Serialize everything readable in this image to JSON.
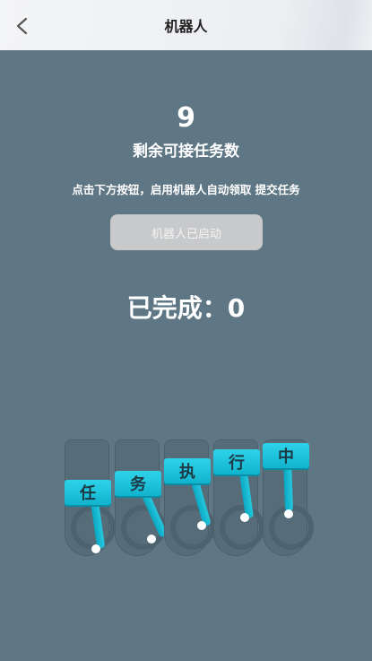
{
  "header": {
    "title": "机器人"
  },
  "task": {
    "remaining_count": "9",
    "remaining_label": "剩余可接任务数",
    "hint": "点击下方按钮，启用机器人自动领取 提交任务",
    "start_button": "机器人已启动",
    "completed": "已完成：0"
  },
  "robot_levers": [
    "任",
    "务",
    "执",
    "行",
    "中"
  ],
  "colors": {
    "background": "#5f7785",
    "accent": "#1fbfd8",
    "button": "#c8c9cb"
  },
  "icons": {
    "back": "chevron-left-icon"
  }
}
